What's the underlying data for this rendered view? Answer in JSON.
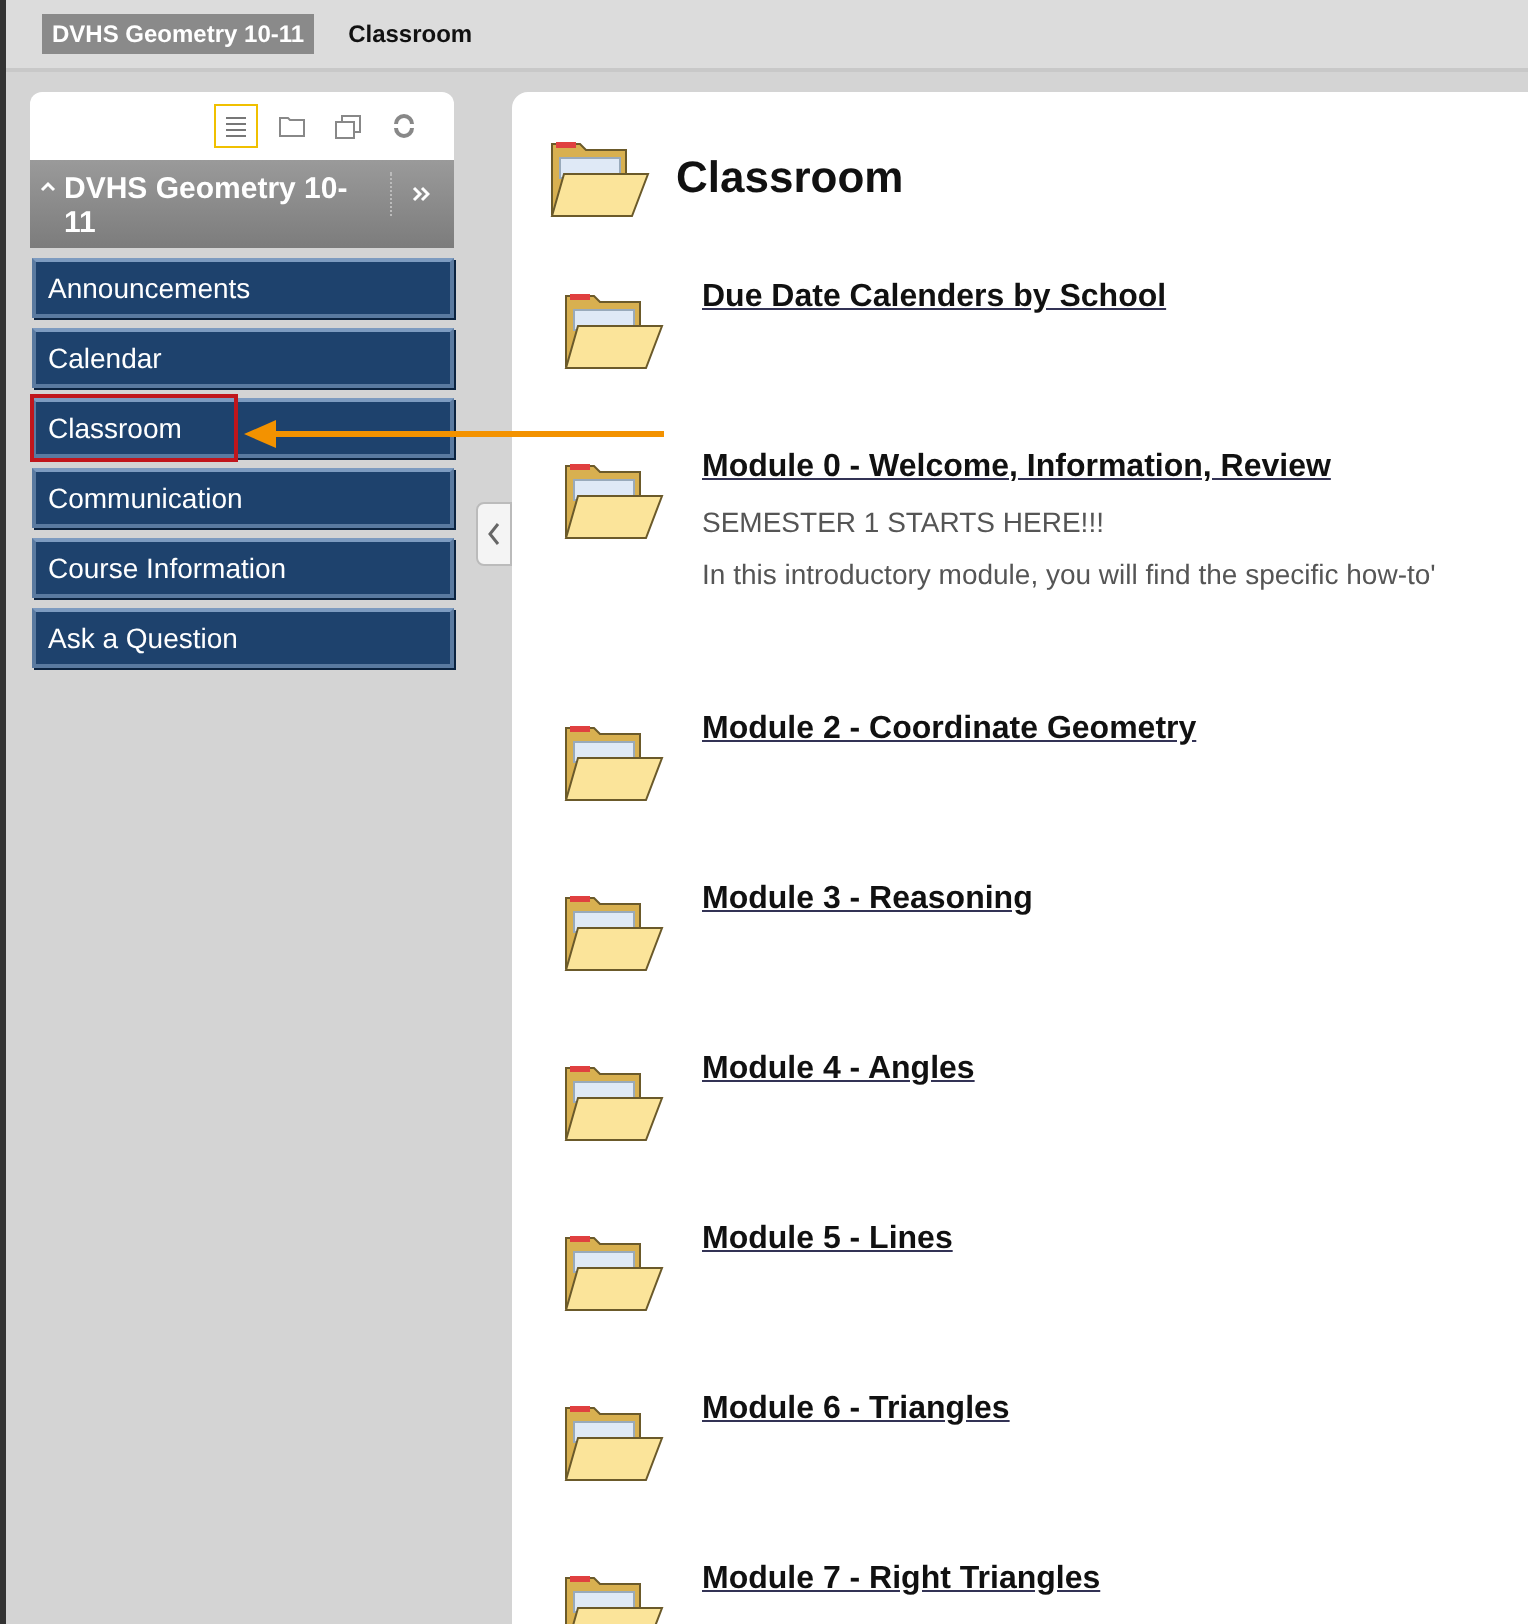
{
  "breadcrumb": [
    {
      "label": "DVHS Geometry 10-11",
      "kind": "course"
    },
    {
      "label": "Classroom",
      "kind": "page"
    }
  ],
  "sidebar": {
    "tools": [
      {
        "selected": true
      },
      {
        "selected": false
      },
      {
        "selected": false
      },
      {
        "selected": false
      }
    ],
    "course_title": "DVHS Geometry 10-11",
    "menu": [
      {
        "label": "Announcements",
        "highlighted": false
      },
      {
        "label": "Calendar",
        "highlighted": false
      },
      {
        "label": "Classroom",
        "highlighted": true
      },
      {
        "label": "Communication",
        "highlighted": false
      },
      {
        "label": "Course Information",
        "highlighted": false
      },
      {
        "label": "Ask a Question",
        "highlighted": false
      }
    ]
  },
  "content": {
    "title": "Classroom",
    "items": [
      {
        "title": "Due Date Calenders by School"
      },
      {
        "title": "Module 0 - Welcome, Information, Review",
        "lines": [
          "SEMESTER 1 STARTS HERE!!!",
          "In this introductory module, you will find the specific how-to'"
        ]
      },
      {
        "title": "Module 2 - Coordinate Geometry"
      },
      {
        "title": "Module 3 - Reasoning"
      },
      {
        "title": "Module 4 - Angles"
      },
      {
        "title": "Module 5 - Lines"
      },
      {
        "title": "Module 6 - Triangles"
      },
      {
        "title": "Module 7 - Right Triangles"
      }
    ]
  }
}
